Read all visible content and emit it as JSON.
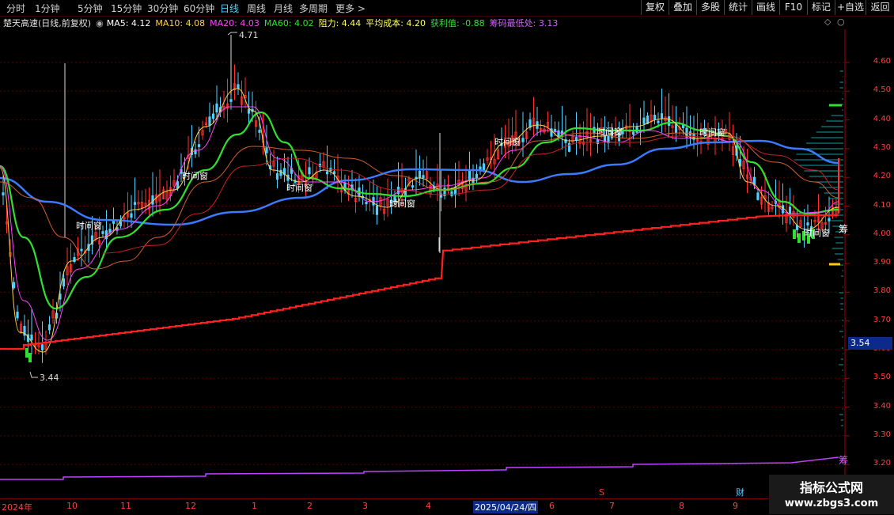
{
  "periods": [
    "分时",
    "1分钟",
    "5分钟",
    "15分钟",
    "30分钟",
    "60分钟",
    "日线",
    "周线",
    "月线",
    "多周期",
    "更多 >"
  ],
  "active_period": "日线",
  "toolbar": [
    "复权",
    "叠加",
    "多股",
    "统计",
    "画线",
    "F10",
    "标记",
    "+自选",
    "返回"
  ],
  "legend": {
    "name": "楚天高速(日线,前复权)",
    "ma5": "MA5: 4.12",
    "ma10": "MA10: 4.08",
    "ma20": "MA20: 4.03",
    "ma60": "MA60: 4.02",
    "resist": "阻力: 4.44",
    "avgcost": "平均成本: 4.20",
    "profit": "获利值: -0.88",
    "chiplow": "筹码最低处: 3.13"
  },
  "colors": {
    "ma5": "#ffffff",
    "ma10": "#ffd24a",
    "ma20": "#ff44ff",
    "ma60": "#30e030",
    "resist": "#ffff66",
    "avgcost": "#ffff66",
    "profit": "#30e030",
    "chiplow": "#d060ff"
  },
  "y_axis": [
    "4.60",
    "4.50",
    "4.40",
    "4.30",
    "4.20",
    "4.10",
    "4.00",
    "3.90",
    "3.80",
    "3.70",
    "3.60",
    "3.50",
    "3.40",
    "3.30",
    "3.20"
  ],
  "price_tag": "3.54",
  "annotations": {
    "high": "4.71",
    "low": "3.44",
    "window": "时间窗",
    "chip": "筹",
    "finance": "财",
    "dividend": "S"
  },
  "dates": [
    "2024年",
    "10",
    "11",
    "12",
    "1",
    "2",
    "3",
    "4",
    "2025/04/24/四",
    "6",
    "7",
    "8",
    "9"
  ],
  "watermark": {
    "line1": "指标公式网",
    "line2": "www.zbgs3.com"
  }
}
